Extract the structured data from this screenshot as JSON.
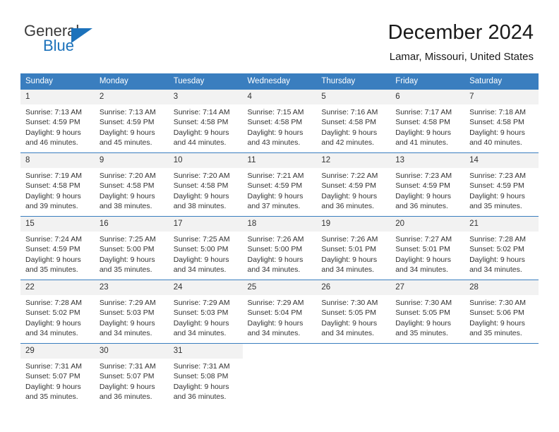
{
  "brand": {
    "name_top": "General",
    "name_bottom": "Blue",
    "triangle_color": "#1c72bb",
    "text_color": "#3b3b3b"
  },
  "header": {
    "title": "December 2024",
    "subtitle": "Lamar, Missouri, United States"
  },
  "theme": {
    "header_blue": "#3a7ebf",
    "daynum_bg": "#f2f2f2",
    "text": "#333333"
  },
  "calendar": {
    "weekday_headers": [
      "Sunday",
      "Monday",
      "Tuesday",
      "Wednesday",
      "Thursday",
      "Friday",
      "Saturday"
    ],
    "weeks": [
      [
        {
          "day": "1",
          "sunrise": "Sunrise: 7:13 AM",
          "sunset": "Sunset: 4:59 PM",
          "daylight1": "Daylight: 9 hours",
          "daylight2": "and 46 minutes."
        },
        {
          "day": "2",
          "sunrise": "Sunrise: 7:13 AM",
          "sunset": "Sunset: 4:59 PM",
          "daylight1": "Daylight: 9 hours",
          "daylight2": "and 45 minutes."
        },
        {
          "day": "3",
          "sunrise": "Sunrise: 7:14 AM",
          "sunset": "Sunset: 4:58 PM",
          "daylight1": "Daylight: 9 hours",
          "daylight2": "and 44 minutes."
        },
        {
          "day": "4",
          "sunrise": "Sunrise: 7:15 AM",
          "sunset": "Sunset: 4:58 PM",
          "daylight1": "Daylight: 9 hours",
          "daylight2": "and 43 minutes."
        },
        {
          "day": "5",
          "sunrise": "Sunrise: 7:16 AM",
          "sunset": "Sunset: 4:58 PM",
          "daylight1": "Daylight: 9 hours",
          "daylight2": "and 42 minutes."
        },
        {
          "day": "6",
          "sunrise": "Sunrise: 7:17 AM",
          "sunset": "Sunset: 4:58 PM",
          "daylight1": "Daylight: 9 hours",
          "daylight2": "and 41 minutes."
        },
        {
          "day": "7",
          "sunrise": "Sunrise: 7:18 AM",
          "sunset": "Sunset: 4:58 PM",
          "daylight1": "Daylight: 9 hours",
          "daylight2": "and 40 minutes."
        }
      ],
      [
        {
          "day": "8",
          "sunrise": "Sunrise: 7:19 AM",
          "sunset": "Sunset: 4:58 PM",
          "daylight1": "Daylight: 9 hours",
          "daylight2": "and 39 minutes."
        },
        {
          "day": "9",
          "sunrise": "Sunrise: 7:20 AM",
          "sunset": "Sunset: 4:58 PM",
          "daylight1": "Daylight: 9 hours",
          "daylight2": "and 38 minutes."
        },
        {
          "day": "10",
          "sunrise": "Sunrise: 7:20 AM",
          "sunset": "Sunset: 4:58 PM",
          "daylight1": "Daylight: 9 hours",
          "daylight2": "and 38 minutes."
        },
        {
          "day": "11",
          "sunrise": "Sunrise: 7:21 AM",
          "sunset": "Sunset: 4:59 PM",
          "daylight1": "Daylight: 9 hours",
          "daylight2": "and 37 minutes."
        },
        {
          "day": "12",
          "sunrise": "Sunrise: 7:22 AM",
          "sunset": "Sunset: 4:59 PM",
          "daylight1": "Daylight: 9 hours",
          "daylight2": "and 36 minutes."
        },
        {
          "day": "13",
          "sunrise": "Sunrise: 7:23 AM",
          "sunset": "Sunset: 4:59 PM",
          "daylight1": "Daylight: 9 hours",
          "daylight2": "and 36 minutes."
        },
        {
          "day": "14",
          "sunrise": "Sunrise: 7:23 AM",
          "sunset": "Sunset: 4:59 PM",
          "daylight1": "Daylight: 9 hours",
          "daylight2": "and 35 minutes."
        }
      ],
      [
        {
          "day": "15",
          "sunrise": "Sunrise: 7:24 AM",
          "sunset": "Sunset: 4:59 PM",
          "daylight1": "Daylight: 9 hours",
          "daylight2": "and 35 minutes."
        },
        {
          "day": "16",
          "sunrise": "Sunrise: 7:25 AM",
          "sunset": "Sunset: 5:00 PM",
          "daylight1": "Daylight: 9 hours",
          "daylight2": "and 35 minutes."
        },
        {
          "day": "17",
          "sunrise": "Sunrise: 7:25 AM",
          "sunset": "Sunset: 5:00 PM",
          "daylight1": "Daylight: 9 hours",
          "daylight2": "and 34 minutes."
        },
        {
          "day": "18",
          "sunrise": "Sunrise: 7:26 AM",
          "sunset": "Sunset: 5:00 PM",
          "daylight1": "Daylight: 9 hours",
          "daylight2": "and 34 minutes."
        },
        {
          "day": "19",
          "sunrise": "Sunrise: 7:26 AM",
          "sunset": "Sunset: 5:01 PM",
          "daylight1": "Daylight: 9 hours",
          "daylight2": "and 34 minutes."
        },
        {
          "day": "20",
          "sunrise": "Sunrise: 7:27 AM",
          "sunset": "Sunset: 5:01 PM",
          "daylight1": "Daylight: 9 hours",
          "daylight2": "and 34 minutes."
        },
        {
          "day": "21",
          "sunrise": "Sunrise: 7:28 AM",
          "sunset": "Sunset: 5:02 PM",
          "daylight1": "Daylight: 9 hours",
          "daylight2": "and 34 minutes."
        }
      ],
      [
        {
          "day": "22",
          "sunrise": "Sunrise: 7:28 AM",
          "sunset": "Sunset: 5:02 PM",
          "daylight1": "Daylight: 9 hours",
          "daylight2": "and 34 minutes."
        },
        {
          "day": "23",
          "sunrise": "Sunrise: 7:29 AM",
          "sunset": "Sunset: 5:03 PM",
          "daylight1": "Daylight: 9 hours",
          "daylight2": "and 34 minutes."
        },
        {
          "day": "24",
          "sunrise": "Sunrise: 7:29 AM",
          "sunset": "Sunset: 5:03 PM",
          "daylight1": "Daylight: 9 hours",
          "daylight2": "and 34 minutes."
        },
        {
          "day": "25",
          "sunrise": "Sunrise: 7:29 AM",
          "sunset": "Sunset: 5:04 PM",
          "daylight1": "Daylight: 9 hours",
          "daylight2": "and 34 minutes."
        },
        {
          "day": "26",
          "sunrise": "Sunrise: 7:30 AM",
          "sunset": "Sunset: 5:05 PM",
          "daylight1": "Daylight: 9 hours",
          "daylight2": "and 34 minutes."
        },
        {
          "day": "27",
          "sunrise": "Sunrise: 7:30 AM",
          "sunset": "Sunset: 5:05 PM",
          "daylight1": "Daylight: 9 hours",
          "daylight2": "and 35 minutes."
        },
        {
          "day": "28",
          "sunrise": "Sunrise: 7:30 AM",
          "sunset": "Sunset: 5:06 PM",
          "daylight1": "Daylight: 9 hours",
          "daylight2": "and 35 minutes."
        }
      ],
      [
        {
          "day": "29",
          "sunrise": "Sunrise: 7:31 AM",
          "sunset": "Sunset: 5:07 PM",
          "daylight1": "Daylight: 9 hours",
          "daylight2": "and 35 minutes."
        },
        {
          "day": "30",
          "sunrise": "Sunrise: 7:31 AM",
          "sunset": "Sunset: 5:07 PM",
          "daylight1": "Daylight: 9 hours",
          "daylight2": "and 36 minutes."
        },
        {
          "day": "31",
          "sunrise": "Sunrise: 7:31 AM",
          "sunset": "Sunset: 5:08 PM",
          "daylight1": "Daylight: 9 hours",
          "daylight2": "and 36 minutes."
        },
        {
          "day": "",
          "sunrise": "",
          "sunset": "",
          "daylight1": "",
          "daylight2": ""
        },
        {
          "day": "",
          "sunrise": "",
          "sunset": "",
          "daylight1": "",
          "daylight2": ""
        },
        {
          "day": "",
          "sunrise": "",
          "sunset": "",
          "daylight1": "",
          "daylight2": ""
        },
        {
          "day": "",
          "sunrise": "",
          "sunset": "",
          "daylight1": "",
          "daylight2": ""
        }
      ]
    ]
  }
}
